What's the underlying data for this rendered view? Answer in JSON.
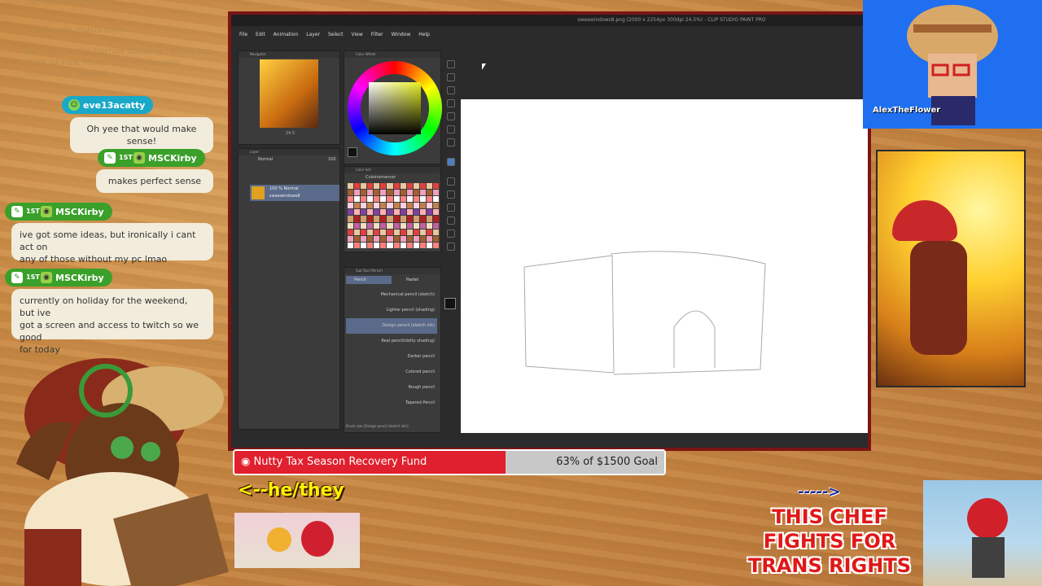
{
  "chat": {
    "ghost_lines": [
      "the summing ways",
      "mushroom mushroom",
      "So a hot cocoa burrow building? Make me",
      "think of how Mario Trad House was",
      "mushroom shaped"
    ],
    "messages": [
      {
        "user": "eve13acatty",
        "color": "#1aa8c8",
        "text": "Oh yee that would make sense!"
      },
      {
        "user": "MSCKirby",
        "color": "#3aa02a",
        "badge": "1ST",
        "text": "makes perfect sense"
      },
      {
        "user": "MSCKirby",
        "color": "#3aa02a",
        "badge": "1ST",
        "text_lines": [
          "ive got some ideas, but ironically i cant act on",
          "any of those without my pc lmao"
        ]
      },
      {
        "user": "MSCKirby",
        "color": "#3aa02a",
        "badge": "1ST",
        "text_lines": [
          "currently on holiday for the weekend, but ive",
          "got a screen and access to twitch so we good",
          "for today"
        ]
      }
    ]
  },
  "app": {
    "title": "sweewindows8.png (2000 x 2254px 300dpi 24.5%) - CLIP STUDIO PAINT PRO",
    "menu": [
      "File",
      "Edit",
      "Animation",
      "Layer",
      "Select",
      "View",
      "Filter",
      "Window",
      "Help"
    ],
    "panels": {
      "navigator": "Navigator",
      "color_wheel": "Color Wheel",
      "layer": "Layer",
      "color_set": "Color Set",
      "color_set_name": "Cuisinomancer",
      "sub_tool": "Sub Tool [Pencil]",
      "blend_mode": "Normal",
      "opacity": "100",
      "zoom": "24.5",
      "tab_pencil": "Pencil",
      "tab_pastel": "Pastel",
      "brush_size_label": "Brush size (Design pencil (sketch ink))"
    },
    "layer_item": {
      "line1": "100 % Normal",
      "line2": "sweewindows8"
    },
    "brushes": [
      "Mechanical pencil (sketch)",
      "Lighter pencil (shading)",
      "Design pencil (sketch ink)",
      "Real pencil(dotty shading)",
      "Darker pencil",
      "Colored pencil",
      "Rough pencil",
      "Tapered Pencil"
    ],
    "selected_brush_index": 2
  },
  "streamer": {
    "name": "AlexTheFlower"
  },
  "fund": {
    "name": "Nutty Tax Season Recovery Fund",
    "progress_text": "63% of $1500 Goal",
    "progress": 0.63
  },
  "pronouns": "<--he/they",
  "arrow": "----->",
  "slogan_lines": [
    "THIS CHEF",
    "FIGHTS FOR",
    "TRANS RIGHTS"
  ],
  "colors": {
    "bar_fill": "#e0202e",
    "win_frame": "#7a1515",
    "avatar_bg": "#1f6ff0"
  }
}
